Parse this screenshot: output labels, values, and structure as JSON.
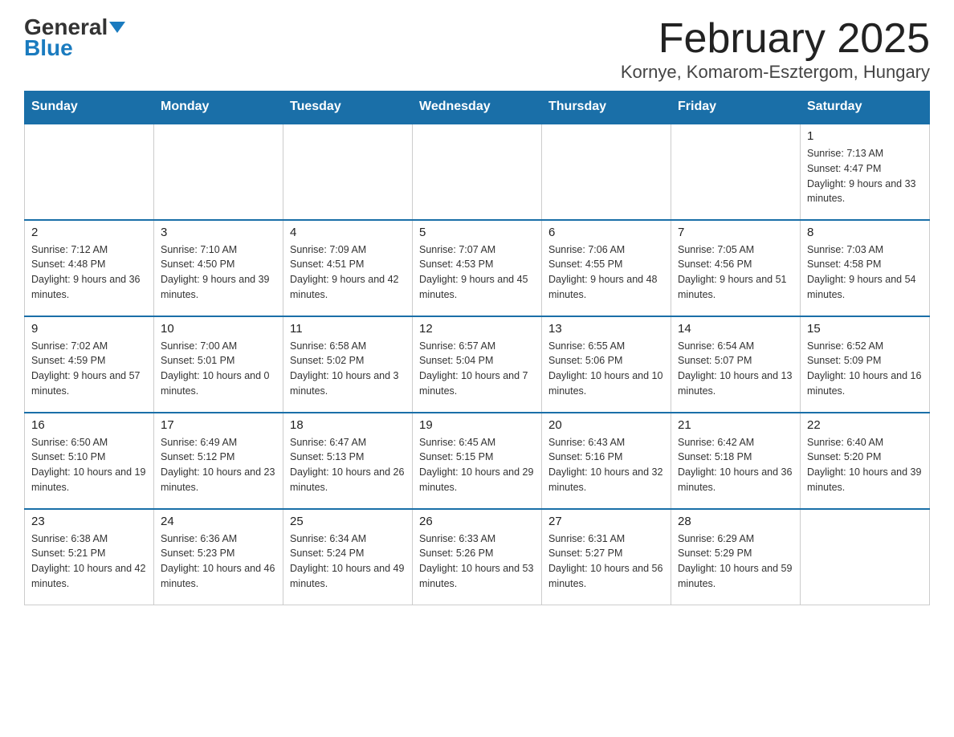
{
  "header": {
    "logo_general": "General",
    "logo_blue": "Blue",
    "title": "February 2025",
    "subtitle": "Kornye, Komarom-Esztergom, Hungary"
  },
  "days_of_week": [
    "Sunday",
    "Monday",
    "Tuesday",
    "Wednesday",
    "Thursday",
    "Friday",
    "Saturday"
  ],
  "weeks": [
    [
      {
        "day": "",
        "info": ""
      },
      {
        "day": "",
        "info": ""
      },
      {
        "day": "",
        "info": ""
      },
      {
        "day": "",
        "info": ""
      },
      {
        "day": "",
        "info": ""
      },
      {
        "day": "",
        "info": ""
      },
      {
        "day": "1",
        "info": "Sunrise: 7:13 AM\nSunset: 4:47 PM\nDaylight: 9 hours and 33 minutes."
      }
    ],
    [
      {
        "day": "2",
        "info": "Sunrise: 7:12 AM\nSunset: 4:48 PM\nDaylight: 9 hours and 36 minutes."
      },
      {
        "day": "3",
        "info": "Sunrise: 7:10 AM\nSunset: 4:50 PM\nDaylight: 9 hours and 39 minutes."
      },
      {
        "day": "4",
        "info": "Sunrise: 7:09 AM\nSunset: 4:51 PM\nDaylight: 9 hours and 42 minutes."
      },
      {
        "day": "5",
        "info": "Sunrise: 7:07 AM\nSunset: 4:53 PM\nDaylight: 9 hours and 45 minutes."
      },
      {
        "day": "6",
        "info": "Sunrise: 7:06 AM\nSunset: 4:55 PM\nDaylight: 9 hours and 48 minutes."
      },
      {
        "day": "7",
        "info": "Sunrise: 7:05 AM\nSunset: 4:56 PM\nDaylight: 9 hours and 51 minutes."
      },
      {
        "day": "8",
        "info": "Sunrise: 7:03 AM\nSunset: 4:58 PM\nDaylight: 9 hours and 54 minutes."
      }
    ],
    [
      {
        "day": "9",
        "info": "Sunrise: 7:02 AM\nSunset: 4:59 PM\nDaylight: 9 hours and 57 minutes."
      },
      {
        "day": "10",
        "info": "Sunrise: 7:00 AM\nSunset: 5:01 PM\nDaylight: 10 hours and 0 minutes."
      },
      {
        "day": "11",
        "info": "Sunrise: 6:58 AM\nSunset: 5:02 PM\nDaylight: 10 hours and 3 minutes."
      },
      {
        "day": "12",
        "info": "Sunrise: 6:57 AM\nSunset: 5:04 PM\nDaylight: 10 hours and 7 minutes."
      },
      {
        "day": "13",
        "info": "Sunrise: 6:55 AM\nSunset: 5:06 PM\nDaylight: 10 hours and 10 minutes."
      },
      {
        "day": "14",
        "info": "Sunrise: 6:54 AM\nSunset: 5:07 PM\nDaylight: 10 hours and 13 minutes."
      },
      {
        "day": "15",
        "info": "Sunrise: 6:52 AM\nSunset: 5:09 PM\nDaylight: 10 hours and 16 minutes."
      }
    ],
    [
      {
        "day": "16",
        "info": "Sunrise: 6:50 AM\nSunset: 5:10 PM\nDaylight: 10 hours and 19 minutes."
      },
      {
        "day": "17",
        "info": "Sunrise: 6:49 AM\nSunset: 5:12 PM\nDaylight: 10 hours and 23 minutes."
      },
      {
        "day": "18",
        "info": "Sunrise: 6:47 AM\nSunset: 5:13 PM\nDaylight: 10 hours and 26 minutes."
      },
      {
        "day": "19",
        "info": "Sunrise: 6:45 AM\nSunset: 5:15 PM\nDaylight: 10 hours and 29 minutes."
      },
      {
        "day": "20",
        "info": "Sunrise: 6:43 AM\nSunset: 5:16 PM\nDaylight: 10 hours and 32 minutes."
      },
      {
        "day": "21",
        "info": "Sunrise: 6:42 AM\nSunset: 5:18 PM\nDaylight: 10 hours and 36 minutes."
      },
      {
        "day": "22",
        "info": "Sunrise: 6:40 AM\nSunset: 5:20 PM\nDaylight: 10 hours and 39 minutes."
      }
    ],
    [
      {
        "day": "23",
        "info": "Sunrise: 6:38 AM\nSunset: 5:21 PM\nDaylight: 10 hours and 42 minutes."
      },
      {
        "day": "24",
        "info": "Sunrise: 6:36 AM\nSunset: 5:23 PM\nDaylight: 10 hours and 46 minutes."
      },
      {
        "day": "25",
        "info": "Sunrise: 6:34 AM\nSunset: 5:24 PM\nDaylight: 10 hours and 49 minutes."
      },
      {
        "day": "26",
        "info": "Sunrise: 6:33 AM\nSunset: 5:26 PM\nDaylight: 10 hours and 53 minutes."
      },
      {
        "day": "27",
        "info": "Sunrise: 6:31 AM\nSunset: 5:27 PM\nDaylight: 10 hours and 56 minutes."
      },
      {
        "day": "28",
        "info": "Sunrise: 6:29 AM\nSunset: 5:29 PM\nDaylight: 10 hours and 59 minutes."
      },
      {
        "day": "",
        "info": ""
      }
    ]
  ]
}
